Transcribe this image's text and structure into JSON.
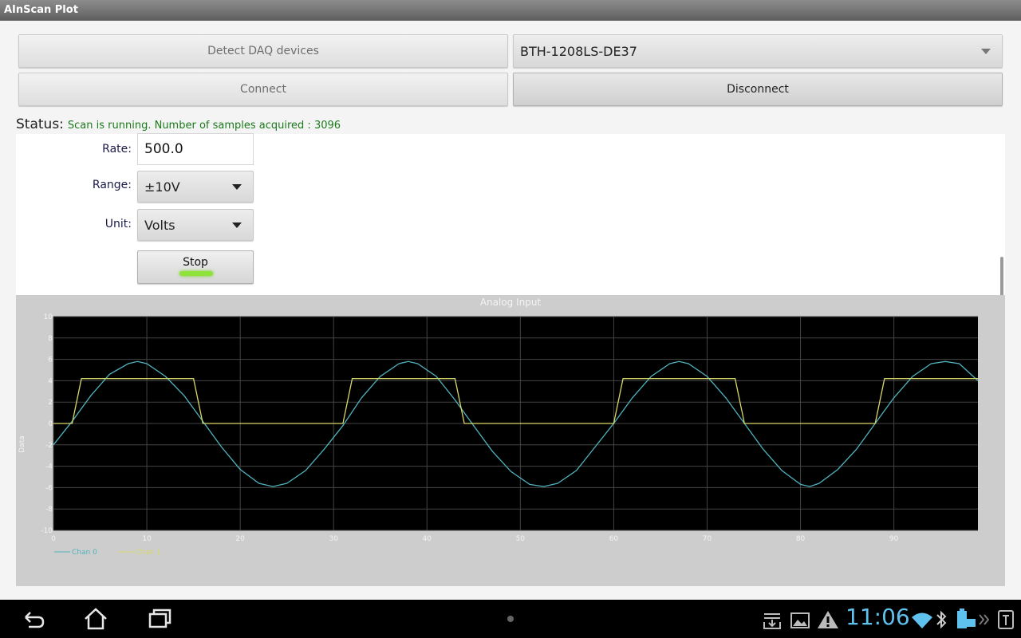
{
  "app": {
    "title": "AInScan Plot"
  },
  "controls": {
    "detect_label": "Detect DAQ devices",
    "device_selected": "BTH-1208LS-DE37",
    "connect_label": "Connect",
    "disconnect_label": "Disconnect"
  },
  "status": {
    "label": "Status:",
    "text": "Scan is running. Number of samples acquired : 3096"
  },
  "settings": {
    "rate_label": "Rate:",
    "rate_value": "500.0",
    "range_label": "Range:",
    "range_value": "±10V",
    "unit_label": "Unit:",
    "unit_value": "Volts",
    "stop_label": "Stop"
  },
  "chart_data": {
    "type": "line",
    "title": "Analog Input",
    "xlabel": "",
    "ylabel": "Data",
    "xlim": [
      0,
      99
    ],
    "ylim": [
      -10,
      10
    ],
    "x_ticks": [
      0,
      10,
      20,
      30,
      40,
      50,
      60,
      70,
      80,
      90
    ],
    "y_ticks": [
      10,
      8,
      6,
      4,
      2,
      0,
      -2,
      -4,
      -6,
      -8,
      -10
    ],
    "grid": true,
    "legend_position": "bottom-left",
    "series": [
      {
        "name": "Chan 0",
        "color": "#4fb3bf",
        "x": [
          0,
          2,
          4,
          6,
          8,
          9,
          10,
          12,
          14,
          16,
          18,
          20,
          22,
          23.5,
          25,
          27,
          29,
          31,
          33,
          35,
          37,
          38,
          39,
          41,
          43,
          45,
          47,
          49,
          51,
          52.5,
          54,
          56,
          58,
          60,
          62,
          64,
          66,
          67,
          68,
          70,
          72,
          74,
          76,
          78,
          80,
          81,
          82,
          84,
          86,
          88,
          90,
          92,
          94,
          95.5,
          97,
          99
        ],
        "values": [
          -2.0,
          0.2,
          2.6,
          4.6,
          5.6,
          5.8,
          5.6,
          4.4,
          2.6,
          0.2,
          -2.2,
          -4.3,
          -5.6,
          -5.9,
          -5.6,
          -4.4,
          -2.4,
          -0.2,
          2.4,
          4.4,
          5.6,
          5.8,
          5.6,
          4.4,
          2.2,
          -0.2,
          -2.6,
          -4.5,
          -5.7,
          -5.9,
          -5.6,
          -4.4,
          -2.2,
          0.0,
          2.4,
          4.4,
          5.6,
          5.8,
          5.6,
          4.4,
          2.4,
          0.0,
          -2.4,
          -4.4,
          -5.7,
          -5.9,
          -5.6,
          -4.3,
          -2.4,
          0.0,
          2.4,
          4.4,
          5.6,
          5.8,
          5.6,
          4.0
        ]
      },
      {
        "name": "Chan 1",
        "color": "#d8d86a",
        "x": [
          0,
          2,
          3,
          15,
          16,
          31,
          32,
          43,
          44,
          60,
          61,
          73,
          74,
          88,
          89,
          99
        ],
        "values": [
          0,
          0,
          4.2,
          4.2,
          0,
          0,
          4.2,
          4.2,
          0,
          0,
          4.2,
          4.2,
          0,
          0,
          4.2,
          4.2
        ]
      }
    ]
  },
  "system": {
    "clock": "11:06"
  }
}
